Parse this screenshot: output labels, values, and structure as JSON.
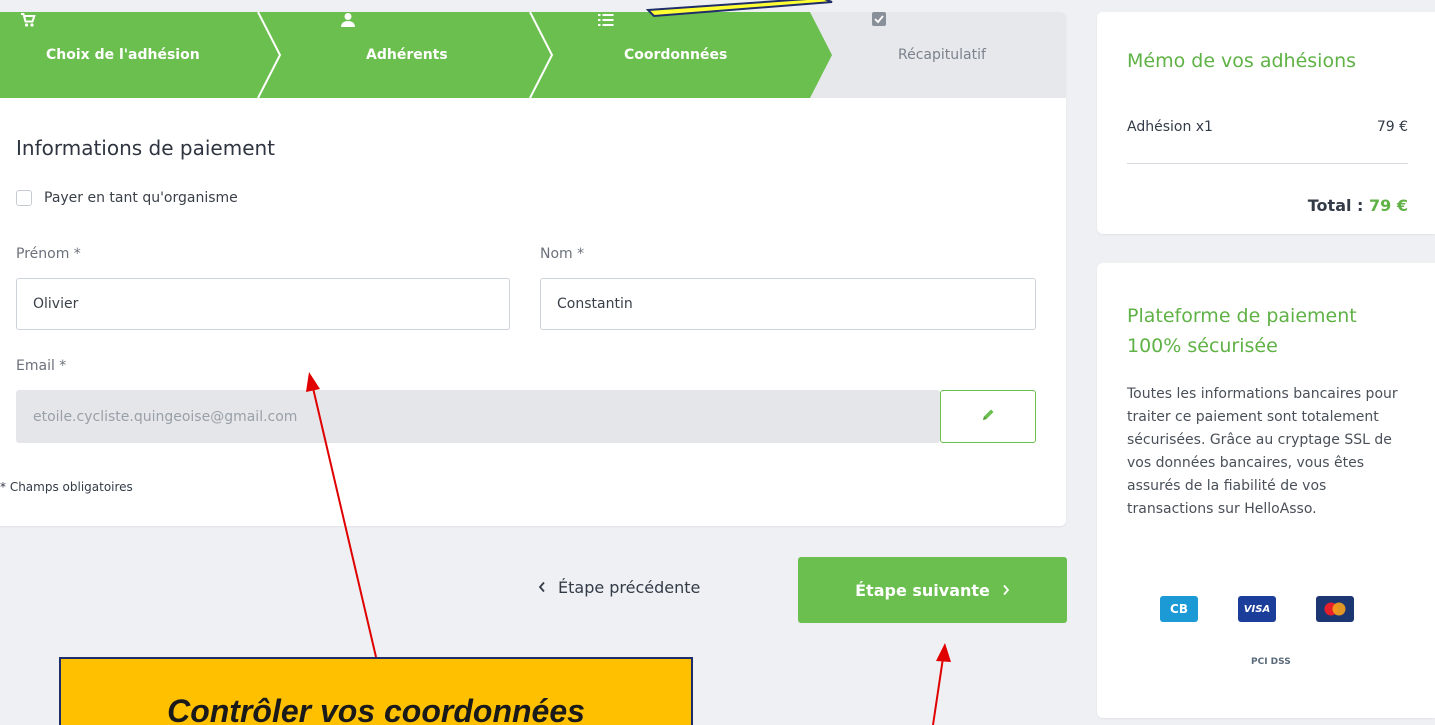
{
  "steps": [
    {
      "label": "Choix de l'adhésion",
      "icon": "cart-icon",
      "state": "done"
    },
    {
      "label": "Adhérents",
      "icon": "user-icon",
      "state": "done"
    },
    {
      "label": "Coordonnées",
      "icon": "list-icon",
      "state": "active"
    },
    {
      "label": "Récapitulatif",
      "icon": "checkbox-icon",
      "state": "upcoming"
    }
  ],
  "form": {
    "title": "Informations de paiement",
    "org_checkbox_label": "Payer en tant qu'organisme",
    "first_name_label": "Prénom *",
    "first_name_value": "Olivier",
    "last_name_label": "Nom *",
    "last_name_value": "Constantin",
    "email_label": "Email *",
    "email_value": "etoile.cycliste.quingeoise@gmail.com",
    "required_note": "* Champs obligatoires"
  },
  "nav": {
    "prev_label": "Étape précédente",
    "next_label": "Étape suivante"
  },
  "memo": {
    "title": "Mémo de vos adhésions",
    "item_label": "Adhésion x1",
    "item_price": "79 €",
    "total_label": "Total :",
    "total_value": "79 €"
  },
  "secure": {
    "title": "Plateforme de paiement 100% sécurisée",
    "text": "Toutes les informations bancaires pour traiter ce paiement sont totalement sécurisées. Grâce au cryptage SSL de vos données bancaires, vous êtes assurés de la fiabilité de vos transactions sur HelloAsso.",
    "card_logos": [
      "CB",
      "VISA"
    ],
    "pci_label": "PCI DSS"
  },
  "annotation": {
    "text": "Contrôler vos coordonnées"
  },
  "colors": {
    "accent": "#6bbf4e",
    "annotation_bg": "#ffc000",
    "arrow": "#e00000"
  }
}
